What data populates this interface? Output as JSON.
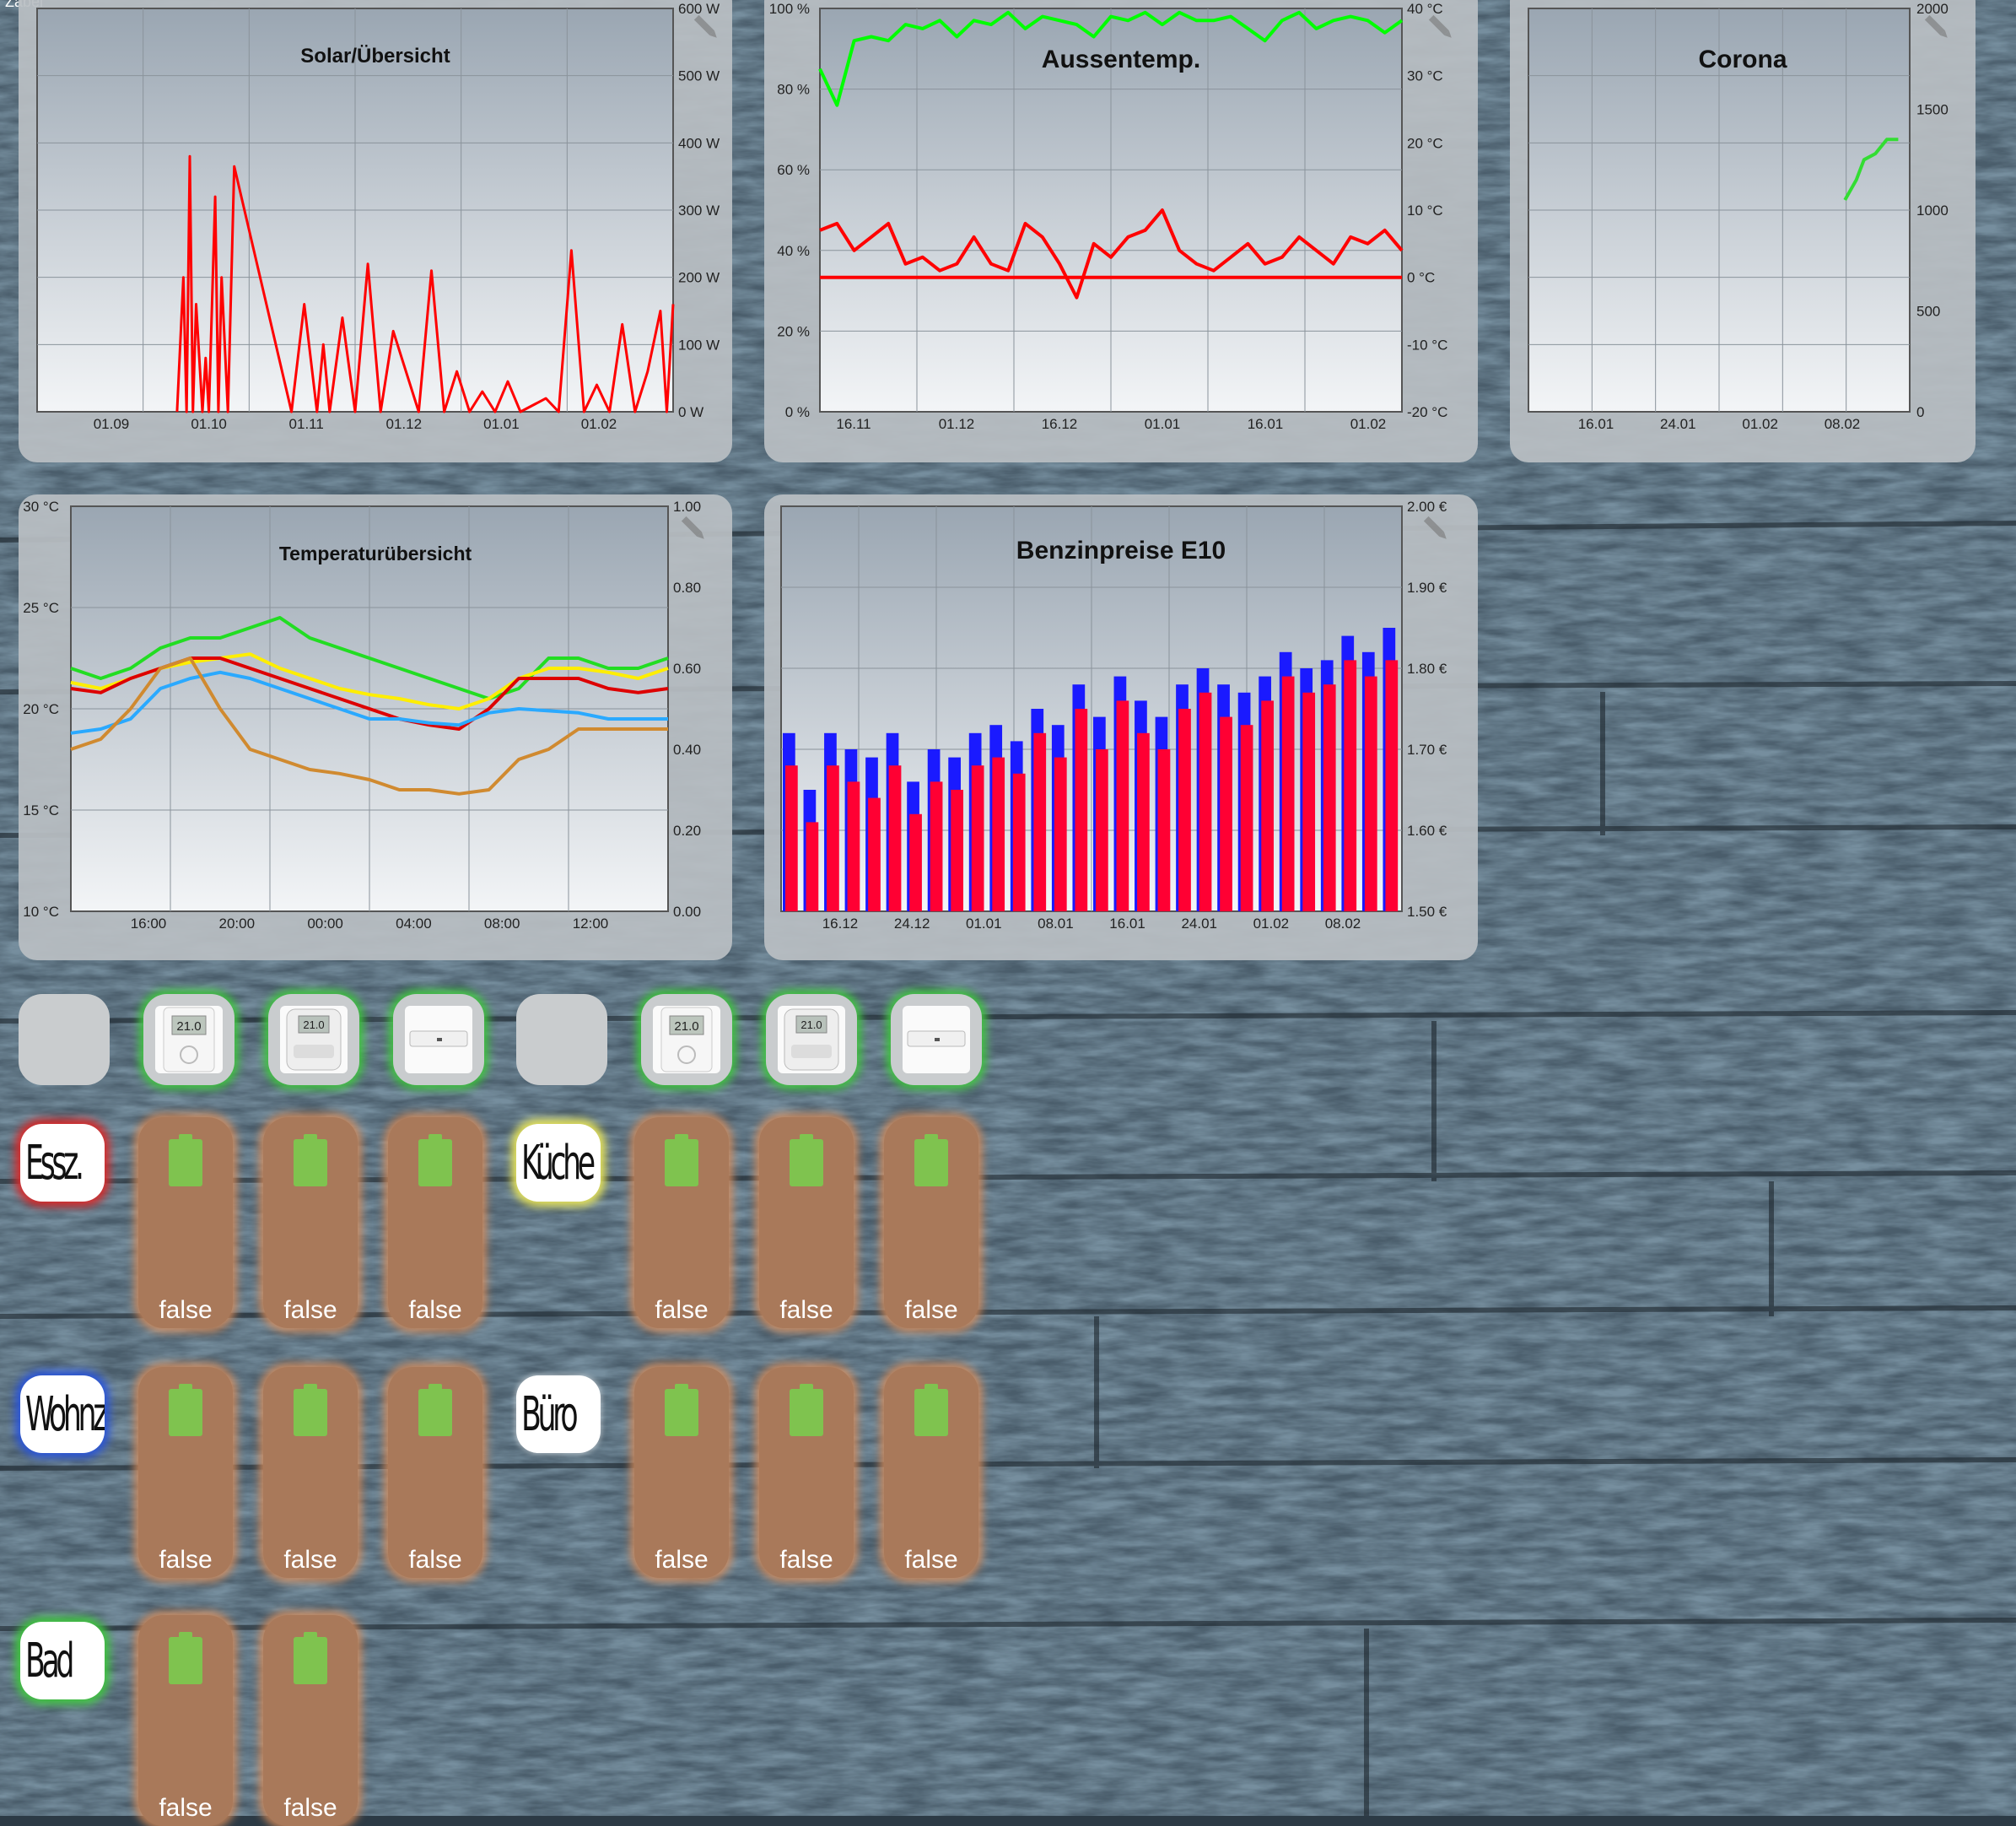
{
  "corner_label": "Zabel",
  "charts": {
    "solar": {
      "title": "Solar/Übersicht"
    },
    "aussen": {
      "title": "Aussentemp."
    },
    "corona": {
      "title": "Corona"
    },
    "temp": {
      "title": "Temperaturübersicht"
    },
    "benzin": {
      "title": "Benzinpreise E10"
    }
  },
  "rooms": {
    "essz": "Essz.",
    "kueche": "Küche",
    "wohnz": "Wohnz.",
    "buero": "Büro",
    "bad": "Bad"
  },
  "battery_value": "false",
  "devices": [
    {
      "type": "blank"
    },
    {
      "type": "wall-thermostat"
    },
    {
      "type": "radiator-thermostat"
    },
    {
      "type": "window-sensor"
    },
    {
      "type": "blank"
    },
    {
      "type": "wall-thermostat"
    },
    {
      "type": "radiator-thermostat"
    },
    {
      "type": "window-sensor"
    }
  ],
  "colors": {
    "red": "#ff0000",
    "green": "#00ff00",
    "blue": "#1a1aff",
    "yellow": "#ffff00",
    "cyan": "#2aa9ff",
    "orange": "#d08a30"
  },
  "chart_data": [
    {
      "type": "line",
      "title": "Solar/Übersicht",
      "x_ticks": [
        "01.09",
        "01.10",
        "01.11",
        "01.12",
        "01.01",
        "01.02"
      ],
      "y_ticks": [
        "0 W",
        "100 W",
        "200 W",
        "300 W",
        "400 W",
        "500 W",
        "600 W"
      ],
      "ylim": [
        0,
        600
      ],
      "series": [
        {
          "color": "#ff0000",
          "x": [
            0.22,
            0.23,
            0.235,
            0.24,
            0.245,
            0.25,
            0.26,
            0.265,
            0.27,
            0.28,
            0.285,
            0.29,
            0.3,
            0.31,
            0.4,
            0.42,
            0.44,
            0.45,
            0.46,
            0.48,
            0.5,
            0.52,
            0.54,
            0.56,
            0.6,
            0.62,
            0.64,
            0.66,
            0.68,
            0.7,
            0.72,
            0.74,
            0.76,
            0.8,
            0.82,
            0.84,
            0.86,
            0.88,
            0.9,
            0.92,
            0.94,
            0.96,
            0.98,
            0.99,
            1.0
          ],
          "values": [
            0,
            200,
            0,
            380,
            0,
            160,
            0,
            80,
            0,
            320,
            0,
            200,
            0,
            365,
            0,
            160,
            0,
            100,
            0,
            140,
            0,
            220,
            0,
            120,
            0,
            210,
            0,
            60,
            0,
            30,
            0,
            45,
            0,
            20,
            0,
            240,
            0,
            40,
            0,
            130,
            0,
            60,
            150,
            0,
            160
          ]
        }
      ]
    },
    {
      "type": "line",
      "title": "Aussentemp.",
      "x_ticks": [
        "16.11",
        "01.12",
        "16.12",
        "01.01",
        "16.01",
        "01.02"
      ],
      "y_ticks_left": [
        "0 %",
        "20 %",
        "40 %",
        "60 %",
        "80 %",
        "100 %"
      ],
      "y_ticks_right": [
        "-20 °C",
        "-10 °C",
        "0 °C",
        "10 °C",
        "20 °C",
        "30 °C",
        "40 °C"
      ],
      "series": [
        {
          "name": "",
          "color": "#00ff00",
          "unit": "%",
          "values": [
            85,
            76,
            92,
            93,
            92,
            96,
            95,
            97,
            93,
            97,
            96,
            99,
            95,
            98,
            97,
            96,
            93,
            98,
            97,
            99,
            96,
            99,
            97,
            97,
            98,
            95,
            92,
            97,
            99,
            95,
            97,
            98,
            97,
            94,
            97
          ]
        },
        {
          "name": "",
          "color": "#ff0000",
          "unit": "°C",
          "values": [
            7,
            8,
            4,
            6,
            8,
            2,
            3,
            1,
            2,
            6,
            2,
            1,
            8,
            6,
            2,
            -3,
            5,
            3,
            6,
            7,
            10,
            4,
            2,
            1,
            3,
            5,
            2,
            3,
            6,
            4,
            2,
            6,
            5,
            7,
            4
          ]
        },
        {
          "name": "",
          "color": "#ff0000",
          "unit": "°C",
          "values": [
            0,
            0
          ]
        }
      ]
    },
    {
      "type": "line",
      "title": "Corona",
      "x_ticks": [
        "16.01",
        "24.01",
        "01.02",
        "08.02"
      ],
      "y_ticks": [
        "0",
        "500",
        "1000",
        "1500",
        "2000"
      ],
      "ylim": [
        0,
        2000
      ],
      "series": [
        {
          "color": "#33dd33",
          "x": [
            0.83,
            0.86,
            0.88,
            0.91,
            0.94,
            0.97
          ],
          "values": [
            1050,
            1150,
            1250,
            1280,
            1350,
            1350
          ]
        }
      ]
    },
    {
      "type": "line",
      "title": "Temperaturübersicht",
      "x_ticks": [
        "16:00",
        "20:00",
        "00:00",
        "04:00",
        "08:00",
        "12:00"
      ],
      "y_ticks_left": [
        "10 °C",
        "15 °C",
        "20 °C",
        "25 °C",
        "30 °C"
      ],
      "y_ticks_right": [
        "0.00",
        "0.20",
        "0.40",
        "0.60",
        "0.80",
        "1.00"
      ],
      "series": [
        {
          "color": "#22dd22",
          "values": [
            22,
            21.5,
            22,
            23,
            23.5,
            23.5,
            24,
            24.5,
            23.5,
            23,
            22.5,
            22,
            21.5,
            21,
            20.5,
            21,
            22.5,
            22.5,
            22,
            22,
            22.5
          ]
        },
        {
          "color": "#ffee00",
          "values": [
            21.3,
            21,
            21.5,
            22,
            22.3,
            22.5,
            22.7,
            22,
            21.5,
            21,
            20.7,
            20.5,
            20.2,
            20,
            20.5,
            21.5,
            22,
            22,
            21.8,
            21.5,
            22
          ]
        },
        {
          "color": "#dd0000",
          "values": [
            21,
            20.8,
            21.5,
            22,
            22.5,
            22.5,
            22,
            21.5,
            21,
            20.5,
            20,
            19.5,
            19.2,
            19,
            20,
            21.5,
            21.5,
            21.5,
            21,
            20.8,
            21
          ]
        },
        {
          "color": "#2aa9ff",
          "values": [
            18.8,
            19,
            19.5,
            21,
            21.5,
            21.8,
            21.5,
            21,
            20.5,
            20,
            19.5,
            19.5,
            19.3,
            19.2,
            19.8,
            20,
            19.9,
            19.8,
            19.5,
            19.5,
            19.5
          ]
        },
        {
          "color": "#d08a30",
          "values": [
            18,
            18.5,
            20,
            22,
            22.5,
            20,
            18,
            17.5,
            17,
            16.8,
            16.5,
            16,
            16,
            15.8,
            16,
            17.5,
            18,
            19,
            19,
            19,
            19
          ]
        }
      ]
    },
    {
      "type": "bar",
      "title": "Benzinpreise E10",
      "x_ticks": [
        "16.12",
        "24.12",
        "01.01",
        "08.01",
        "16.01",
        "24.01",
        "01.02",
        "08.02"
      ],
      "y_ticks": [
        "1.50 €",
        "1.60 €",
        "1.70 €",
        "1.80 €",
        "1.90 €",
        "2.00 €"
      ],
      "ylim": [
        1.5,
        2.0
      ],
      "series": [
        {
          "name": "",
          "color": "#1a1aff",
          "values": [
            1.72,
            1.65,
            1.72,
            1.7,
            1.69,
            1.72,
            1.66,
            1.7,
            1.69,
            1.72,
            1.73,
            1.71,
            1.75,
            1.73,
            1.78,
            1.74,
            1.79,
            1.76,
            1.74,
            1.78,
            1.8,
            1.78,
            1.77,
            1.79,
            1.82,
            1.8,
            1.81,
            1.84,
            1.82,
            1.85
          ]
        },
        {
          "name": "",
          "color": "#ff0033",
          "values": [
            1.68,
            1.61,
            1.68,
            1.66,
            1.64,
            1.68,
            1.62,
            1.66,
            1.65,
            1.68,
            1.69,
            1.67,
            1.72,
            1.69,
            1.75,
            1.7,
            1.76,
            1.72,
            1.7,
            1.75,
            1.77,
            1.74,
            1.73,
            1.76,
            1.79,
            1.77,
            1.78,
            1.81,
            1.79,
            1.81
          ]
        }
      ]
    }
  ]
}
